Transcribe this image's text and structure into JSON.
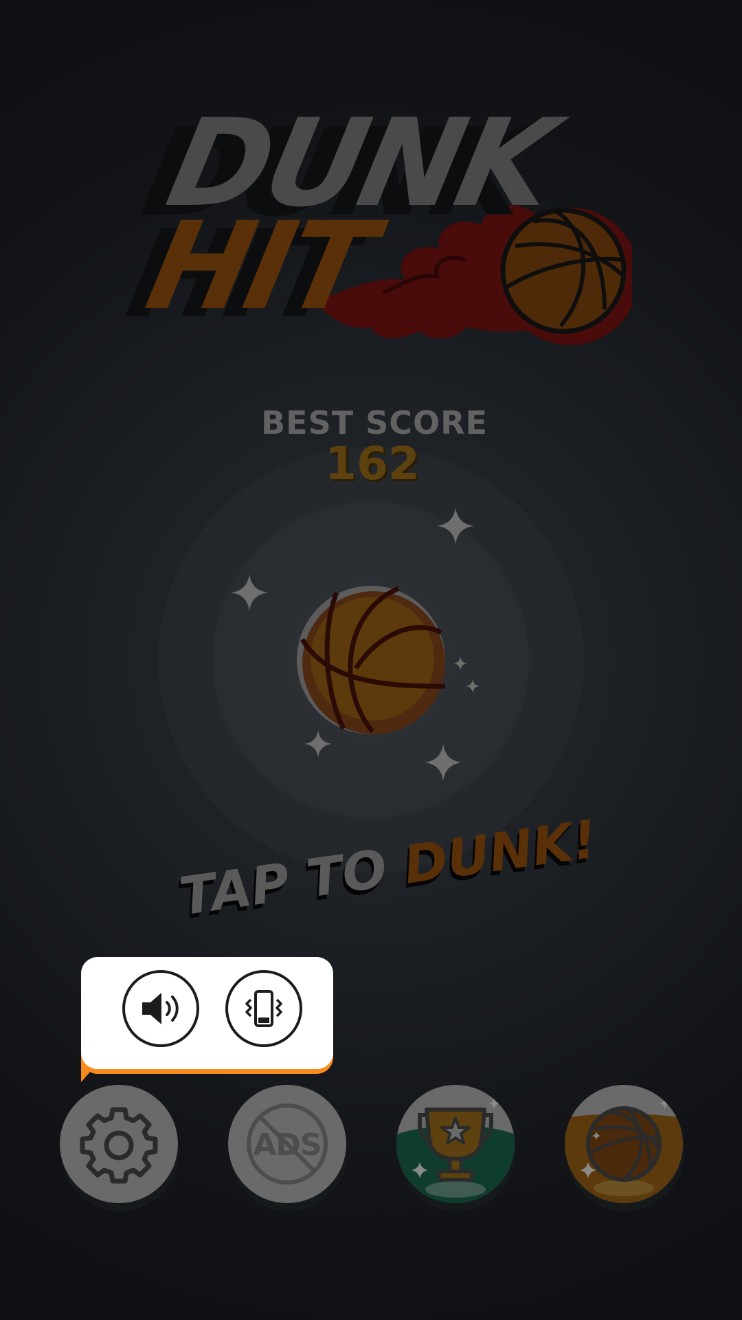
{
  "logo": {
    "line1": "DUNK",
    "line2": "HIT"
  },
  "best_score": {
    "label": "BEST SCORE",
    "value": "162"
  },
  "tap_prompt": {
    "part1": "TAP TO ",
    "part2": "DUNK!"
  },
  "settings_popup": {
    "sound_icon": "speaker-icon",
    "vibration_icon": "phone-vibrate-icon"
  },
  "bottom_bar": {
    "settings_icon": "gear-icon",
    "no_ads_label": "ADS",
    "no_ads_icon": "no-ads-icon",
    "trophy_icon": "trophy-star-icon",
    "balls_icon": "basketball-icon"
  },
  "colors": {
    "background": "#101216",
    "accent_orange": "#f68b1f",
    "score_gold": "#5d4210",
    "trophy_green": "#0e3d2e",
    "ball_orange": "#5c3a0b"
  }
}
